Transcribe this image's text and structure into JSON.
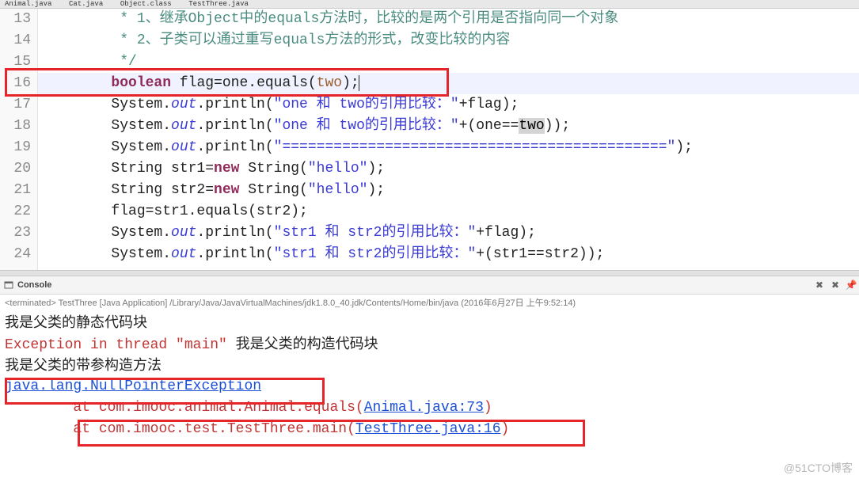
{
  "tabs": {
    "t1": "Animal.java",
    "t2": "Cat.java",
    "t3": "Object.class",
    "t4": "TestThree.java"
  },
  "gutter": {
    "l13": "13",
    "l14": "14",
    "l15": "15",
    "l16": "16",
    "l17": "17",
    "l18": "18",
    "l19": "19",
    "l20": "20",
    "l21": "21",
    "l22": "22",
    "l23": "23",
    "l24": "24"
  },
  "code": {
    "c13_a": "         * 1、继承Object中的equals方法时，比较的是两个引用是否指向同一个对象",
    "c14_a": "         * 2、子类可以通过重写equals方法的形式，改变比较的内容",
    "c15_a": "         */",
    "c16_kw": "boolean",
    "c16_sp1": "        ",
    "c16_mid": " flag=one.equals(",
    "c16_arg": "two",
    "c16_end": ");",
    "c17_pre": "        System.",
    "c17_out": "out",
    "c17_call": ".println(",
    "c17_str": "\"one 和 two的引用比较：\"",
    "c17_tail": "+flag);",
    "c18_pre": "        System.",
    "c18_out": "out",
    "c18_call": ".println(",
    "c18_str": "\"one 和 two的引用比较：\"",
    "c18_tail1": "+(one==",
    "c18_two": "two",
    "c18_tail2": "));",
    "c19_pre": "        System.",
    "c19_out": "out",
    "c19_call": ".println(",
    "c19_str": "\"=============================================\"",
    "c19_tail": ");",
    "c20_pre": "        String str1=",
    "c20_new": "new",
    "c20_mid": " String(",
    "c20_str": "\"hello\"",
    "c20_end": ");",
    "c21_pre": "        String str2=",
    "c21_new": "new",
    "c21_mid": " String(",
    "c21_str": "\"hello\"",
    "c21_end": ");",
    "c22_a": "        flag=str1.equals(str2);",
    "c23_pre": "        System.",
    "c23_out": "out",
    "c23_call": ".println(",
    "c23_str": "\"str1 和 str2的引用比较：\"",
    "c23_tail": "+flag);",
    "c24_pre": "        System.",
    "c24_out": "out",
    "c24_call": ".println(",
    "c24_str": "\"str1 和 str2的引用比较：\"",
    "c24_tail": "+(str1==str2));"
  },
  "console": {
    "title": "Console",
    "meta": "<terminated> TestThree [Java Application] /Library/Java/JavaVirtualMachines/jdk1.8.0_40.jdk/Contents/Home/bin/java (2016年6月27日 上午9:52:14)",
    "l1": "我是父类的静态代码块",
    "l2_a": "Exception in thread \"main\" ",
    "l2_b": "我是父类的构造代码块",
    "l3": "我是父类的带参构造方法",
    "l4": "java.lang.NullPointerException",
    "l5_a": "\tat com.imooc.animal.Animal.equals(",
    "l5_link": "Animal.java:73",
    "l5_b": ")",
    "l6_a": "\tat com.imooc.test.TestThree.main(",
    "l6_link": "TestThree.java:16",
    "l6_b": ")"
  },
  "icons": {
    "close": "✕",
    "clearx": "✖",
    "pin": "📌"
  },
  "watermark": "@51CTO博客"
}
